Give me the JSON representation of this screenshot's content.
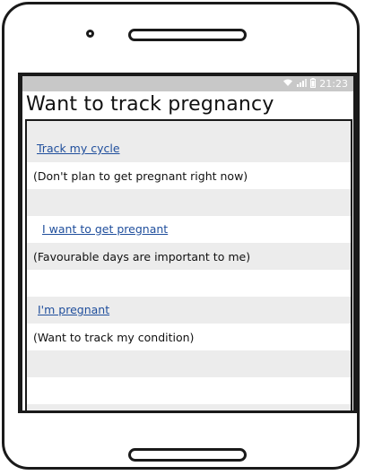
{
  "status_bar": {
    "time": "21:23",
    "icons": [
      "wifi-icon",
      "signal-icon",
      "battery-icon"
    ]
  },
  "screen": {
    "title": "Want to track pregnancy"
  },
  "options": [
    {
      "link": "Track my cycle",
      "description": "(Don't plan to get pregnant right now)"
    },
    {
      "link": "I want to get pregnant",
      "description": "(Favourable days are important to me)"
    },
    {
      "link": "I'm pregnant",
      "description": "(Want to track my condition)"
    }
  ],
  "colors": {
    "link": "#1f4e9c",
    "row_alt": "#ececec",
    "status_bar": "#c8c8c8"
  }
}
